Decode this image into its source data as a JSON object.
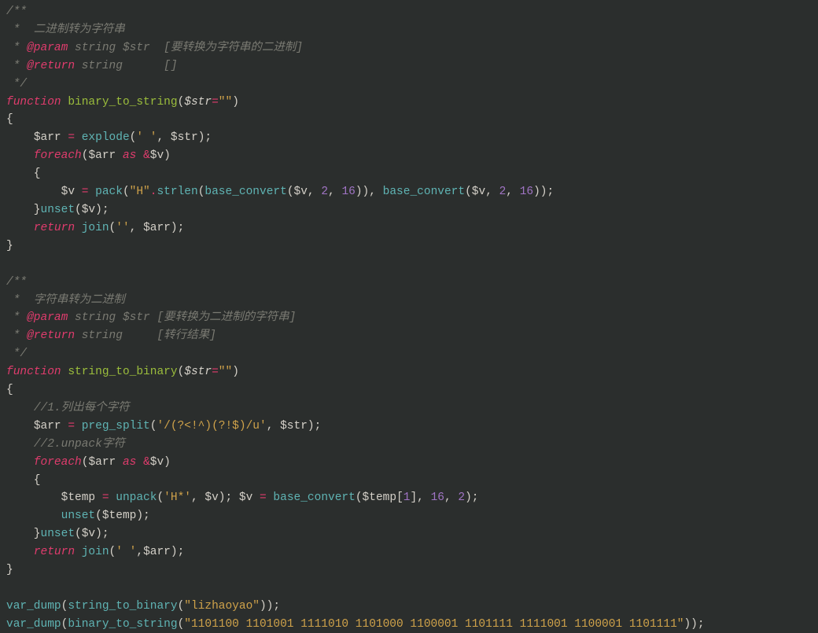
{
  "code": {
    "block1": {
      "doc_open": "/**",
      "doc_l1_star": " * ",
      "doc_l1_text": " 二进制转为字符串",
      "doc_l2_star": " * ",
      "doc_l2_tag": "@param",
      "doc_l2_after": " string $str  [要转换为字符串的二进制]",
      "doc_l3_star": " * ",
      "doc_l3_tag": "@return",
      "doc_l3_after": " string      []",
      "doc_close": " */",
      "fn_kw": "function",
      "fn_name": " binary_to_string",
      "fn_sig_open": "(",
      "fn_param": "$str",
      "fn_eq": "=",
      "fn_default": "\"\"",
      "fn_sig_close": ")",
      "brace_open": "{",
      "l1_indent": "    ",
      "l1_var": "$arr",
      "l1_eq": " = ",
      "l1_fn": "explode",
      "l1_open": "(",
      "l1_arg1": "' '",
      "l1_comma": ", ",
      "l1_arg2": "$str",
      "l1_close": ");",
      "l2_indent": "    ",
      "l2_kw": "foreach",
      "l2_open": "(",
      "l2_arr": "$arr",
      "l2_as": " as ",
      "l2_amp": "&",
      "l2_v": "$v",
      "l2_close": ")",
      "l3": "    {",
      "l4_indent": "        ",
      "l4_v": "$v",
      "l4_eq": " = ",
      "l4_pack": "pack",
      "l4_open": "(",
      "l4_str": "\"H\"",
      "l4_dot": ".",
      "l4_strlen": "strlen",
      "l4_o2": "(",
      "l4_bc1": "base_convert",
      "l4_o3": "(",
      "l4_vv": "$v",
      "l4_c1": ", ",
      "l4_n2": "2",
      "l4_c2": ", ",
      "l4_n16": "16",
      "l4_cl3": ")), ",
      "l4_bc2": "base_convert",
      "l4_o4": "(",
      "l4_vv2": "$v",
      "l4_c3": ", ",
      "l4_n2b": "2",
      "l4_c4": ", ",
      "l4_n16b": "16",
      "l4_cl4": "));",
      "l5_close": "    }",
      "l5_unset": "unset",
      "l5_open": "(",
      "l5_v": "$v",
      "l5_cl": ");",
      "l6_indent": "    ",
      "l6_kw": "return",
      "l6_sp": " ",
      "l6_join": "join",
      "l6_open": "(",
      "l6_str": "''",
      "l6_c": ", ",
      "l6_arr": "$arr",
      "l6_cl": ");",
      "brace_close": "}"
    },
    "block2": {
      "doc_open": "/**",
      "doc_l1_star": " * ",
      "doc_l1_text": " 字符串转为二进制",
      "doc_l2_star": " * ",
      "doc_l2_tag": "@param",
      "doc_l2_after": " string $str [要转换为二进制的字符串]",
      "doc_l3_star": " * ",
      "doc_l3_tag": "@return",
      "doc_l3_after": " string     [转行结果]",
      "doc_close": " */",
      "fn_kw": "function",
      "fn_name": " string_to_binary",
      "fn_sig_open": "(",
      "fn_param": "$str",
      "fn_eq": "=",
      "fn_default": "\"\"",
      "fn_sig_close": ")",
      "brace_open": "{",
      "c1_indent": "    ",
      "c1_text": "//1.列出每个字符",
      "l1_indent": "    ",
      "l1_var": "$arr",
      "l1_eq": " = ",
      "l1_fn": "preg_split",
      "l1_open": "(",
      "l1_arg1": "'/(?<!^)(?!$)/u'",
      "l1_comma": ", ",
      "l1_arg2": "$str",
      "l1_close": ");",
      "c2_indent": "    ",
      "c2_text": "//2.unpack字符",
      "l2_indent": "    ",
      "l2_kw": "foreach",
      "l2_open": "(",
      "l2_arr": "$arr",
      "l2_as": " as ",
      "l2_amp": "&",
      "l2_v": "$v",
      "l2_close": ")",
      "l3": "    {",
      "l4_indent": "        ",
      "l4_temp": "$temp",
      "l4_eq": " = ",
      "l4_unpack": "unpack",
      "l4_open": "(",
      "l4_str": "'H*'",
      "l4_c": ", ",
      "l4_v": "$v",
      "l4_cl": "); ",
      "l4_v2": "$v",
      "l4_eq2": " = ",
      "l4_bc": "base_convert",
      "l4_o2": "(",
      "l4_temp2": "$temp",
      "l4_br": "[",
      "l4_idx": "1",
      "l4_br2": "], ",
      "l4_n16": "16",
      "l4_c2": ", ",
      "l4_n2": "2",
      "l4_cl2": ");",
      "l5_indent": "        ",
      "l5_unset": "unset",
      "l5_open": "(",
      "l5_temp": "$temp",
      "l5_cl": ");",
      "l6_close": "    }",
      "l6_unset": "unset",
      "l6_open": "(",
      "l6_v": "$v",
      "l6_cl": ");",
      "l7_indent": "    ",
      "l7_kw": "return",
      "l7_sp": " ",
      "l7_join": "join",
      "l7_open": "(",
      "l7_str": "' '",
      "l7_c": ",",
      "l7_arr": "$arr",
      "l7_cl": ");",
      "brace_close": "}"
    },
    "calls": {
      "c1_fn": "var_dump",
      "c1_open": "(",
      "c1_inner": "string_to_binary",
      "c1_o2": "(",
      "c1_arg": "\"lizhaoyao\"",
      "c1_cl": "));",
      "c2_fn": "var_dump",
      "c2_open": "(",
      "c2_inner": "binary_to_string",
      "c2_o2": "(",
      "c2_arg": "\"1101100 1101001 1111010 1101000 1100001 1101111 1111001 1100001 1101111\"",
      "c2_cl": "));"
    }
  }
}
